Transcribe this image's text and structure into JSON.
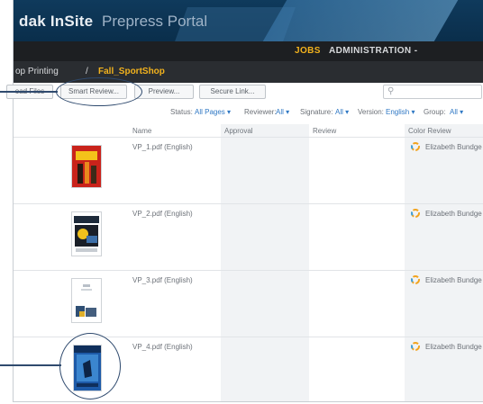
{
  "app": {
    "brand_strong": "dak InSite",
    "brand_light": "Prepress Portal"
  },
  "nav": {
    "jobs": "JOBS",
    "administration": "ADMINISTRATION -"
  },
  "breadcrumb": {
    "parent": "op Printing",
    "separator": "/",
    "current": "Fall_SportShop"
  },
  "toolbar": {
    "upload_label": "oad Files",
    "smart_review_label": "Smart Review...",
    "preview_label": "Preview...",
    "secure_link_label": "Secure Link...",
    "search_placeholder": ""
  },
  "filters": {
    "status_label": "Status:",
    "status_value": "All Pages ▾",
    "reviewer_label": "Reviewer:",
    "reviewer_value": "All ▾",
    "signature_label": "Signature:",
    "signature_value": "All ▾",
    "version_label": "Version:",
    "version_value": "English ▾",
    "group_label": "Group:",
    "group_value": "All ▾"
  },
  "table": {
    "columns": [
      "Name",
      "Approval",
      "Review",
      "Color Review"
    ],
    "rows": [
      {
        "name": "VP_1.pdf (English)",
        "reviewer": "Elizabeth Bundge"
      },
      {
        "name": "VP_2.pdf (English)",
        "reviewer": "Elizabeth Bundge"
      },
      {
        "name": "VP_3.pdf (English)",
        "reviewer": "Elizabeth Bundge"
      },
      {
        "name": "VP_4.pdf (English)",
        "reviewer": "Elizabeth Bundge"
      }
    ]
  },
  "colors": {
    "accent": "#f2b21d",
    "link": "#2f78c4",
    "annotation": "#2f4a6e"
  }
}
